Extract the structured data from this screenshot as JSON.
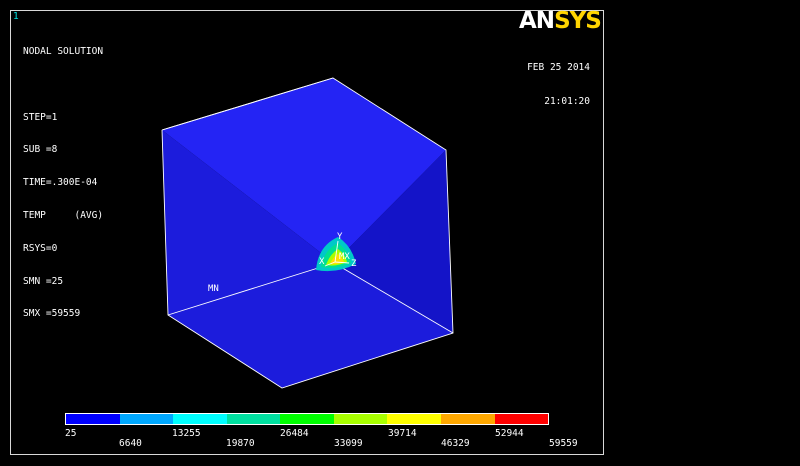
{
  "window_number": "1",
  "info_lines": [
    "NODAL SOLUTION",
    "",
    "STEP=1",
    "SUB =8",
    "TIME=.300E-04",
    "TEMP     (AVG)",
    "RSYS=0",
    "SMN =25",
    "SMX =59559"
  ],
  "brand": {
    "part1": "AN",
    "part2": "SYS"
  },
  "date": "FEB 25 2014",
  "time": "21:01:20",
  "labels": {
    "mn": "MN",
    "mx": "MX",
    "axis_y": "Y",
    "axis_x": "X",
    "axis_z": "Z"
  },
  "colors": {
    "cube_top": "#2424f4",
    "cube_left": "#1c1cdc",
    "cube_right": "#1414c8",
    "edge": "#ffffff",
    "brand_accent": "#ffd400"
  },
  "legend": {
    "colors": [
      "#0000ff",
      "#00a8ff",
      "#00ffff",
      "#00e0a0",
      "#00ff00",
      "#a8ff00",
      "#ffff00",
      "#ffa800",
      "#ff0000"
    ],
    "labels_top": [
      "25",
      "13255",
      "26484",
      "39714",
      "52944"
    ],
    "labels_bottom": [
      "6640",
      "19870",
      "33099",
      "46329",
      "59559"
    ]
  }
}
